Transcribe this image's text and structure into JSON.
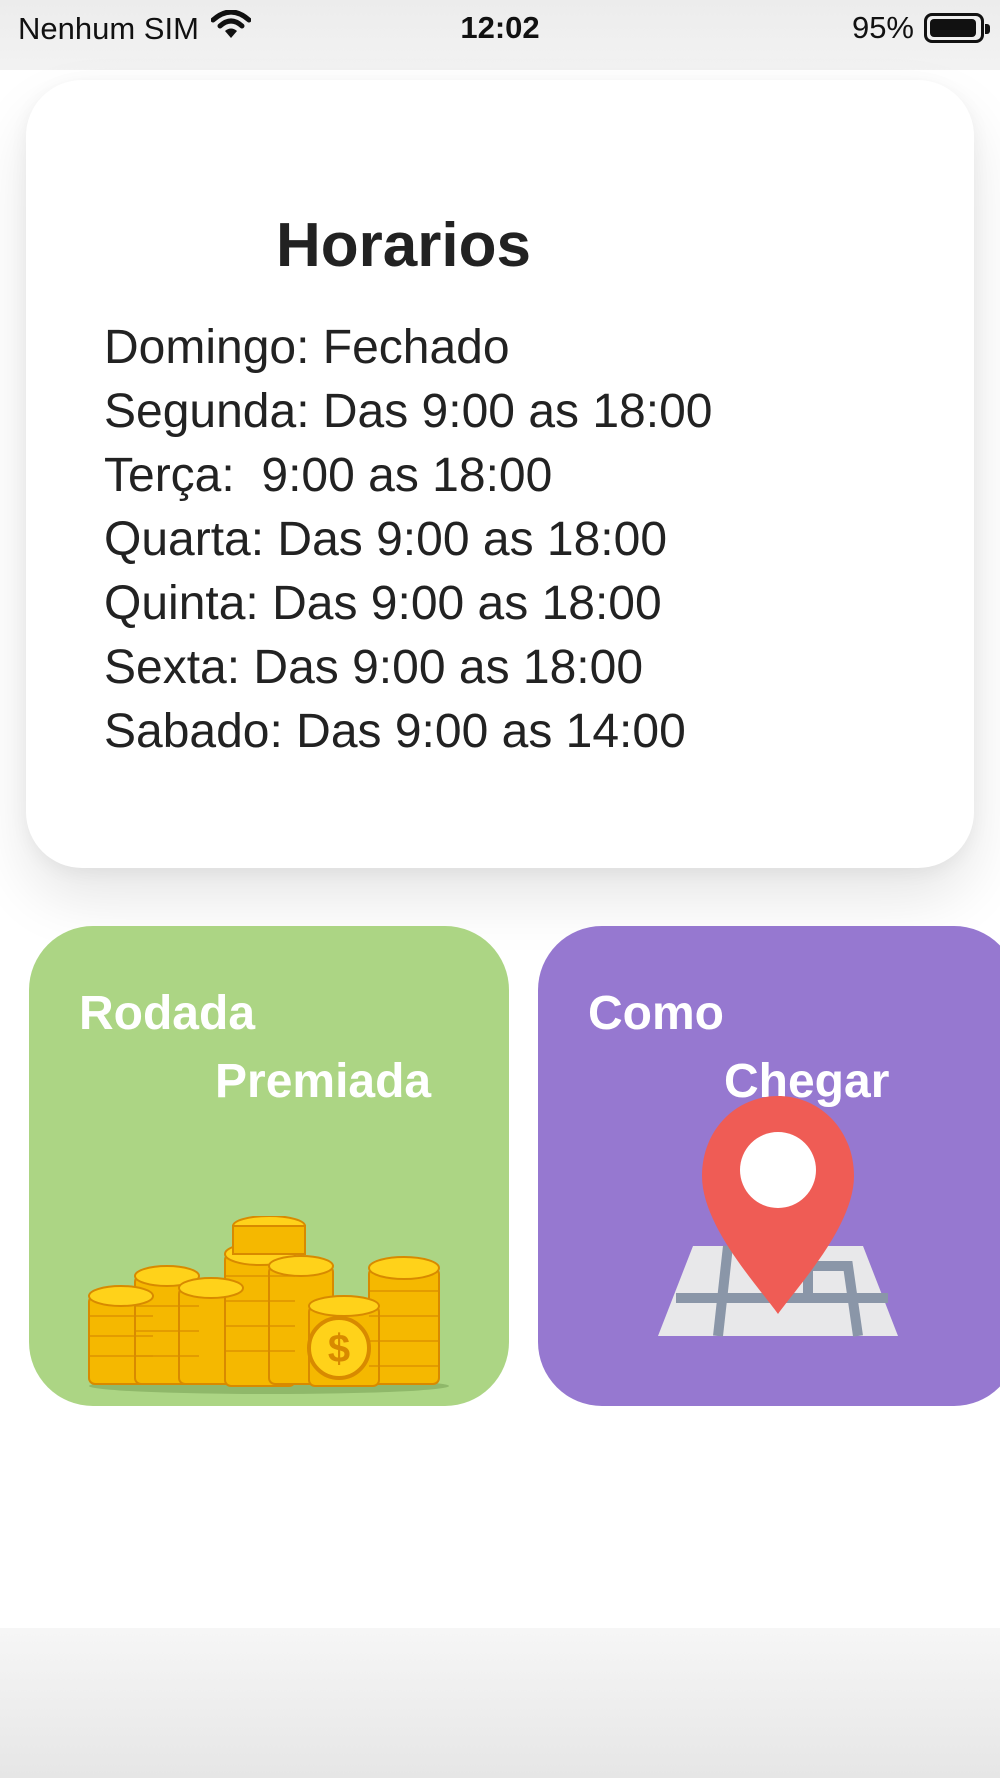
{
  "status_bar": {
    "carrier": "Nenhum SIM",
    "time": "12:02",
    "battery": "95%",
    "battery_level": 0.95,
    "icons": [
      "wifi-icon",
      "battery-icon"
    ]
  },
  "hours_card": {
    "title": "Horarios",
    "lines": [
      "Domingo: Fechado",
      "Segunda: Das 9:00 as 18:00",
      "Terça:  9:00 as 18:00",
      "Quarta: Das 9:00 as 18:00",
      "Quinta: Das 9:00 as 18:00",
      "Sexta: Das 9:00 as 18:00",
      "Sabado: Das 9:00 as 14:00"
    ]
  },
  "tiles": [
    {
      "line1": "Rodada",
      "line2": "Premiada",
      "icon": "coins-icon",
      "color": "#acd584"
    },
    {
      "line1": "Como",
      "line2": "Chegar",
      "icon": "map-pin-icon",
      "color": "#9678d0"
    }
  ],
  "colors": {
    "green_tile": "#acd584",
    "purple_tile": "#9678d0",
    "pin_red": "#ef5c55"
  }
}
